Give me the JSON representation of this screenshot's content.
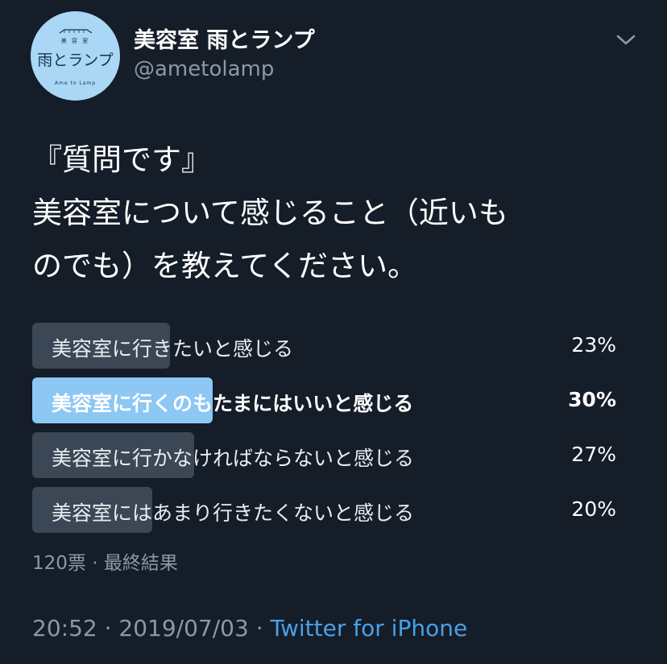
{
  "header": {
    "avatar": {
      "line1": "美 容 室",
      "line2": "雨とランプ",
      "line3": "Ame to Lamp"
    },
    "display_name": "美容室 雨とランプ",
    "handle": "@ametolamp",
    "menu_icon": "chevron-down-icon"
  },
  "tweet": {
    "text": "『質問です』\n美容室について感じること（近いも\nのでも）を教えてください。"
  },
  "poll": {
    "options": [
      {
        "label": "美容室に行きたいと感じる",
        "percent": "23%",
        "value": 23,
        "winner": false
      },
      {
        "label": "美容室に行くのもたまにはいいと感じる",
        "percent": "30%",
        "value": 30,
        "winner": true
      },
      {
        "label": "美容室に行かなければならないと感じる",
        "percent": "27%",
        "value": 27,
        "winner": false
      },
      {
        "label": "美容室にはあまり行きたくないと感じる",
        "percent": "20%",
        "value": 20,
        "winner": false
      }
    ],
    "votes": "120票",
    "separator": "·",
    "status": "最終結果"
  },
  "footer": {
    "time": "20:52",
    "separator": "·",
    "date": "2019/07/03",
    "source": "Twitter for iPhone"
  },
  "colors": {
    "background": "#151d28",
    "bar": "#3b4755",
    "winner_bar": "#8dc7f3",
    "link": "#4aa0e6",
    "muted": "#8c98a6"
  }
}
